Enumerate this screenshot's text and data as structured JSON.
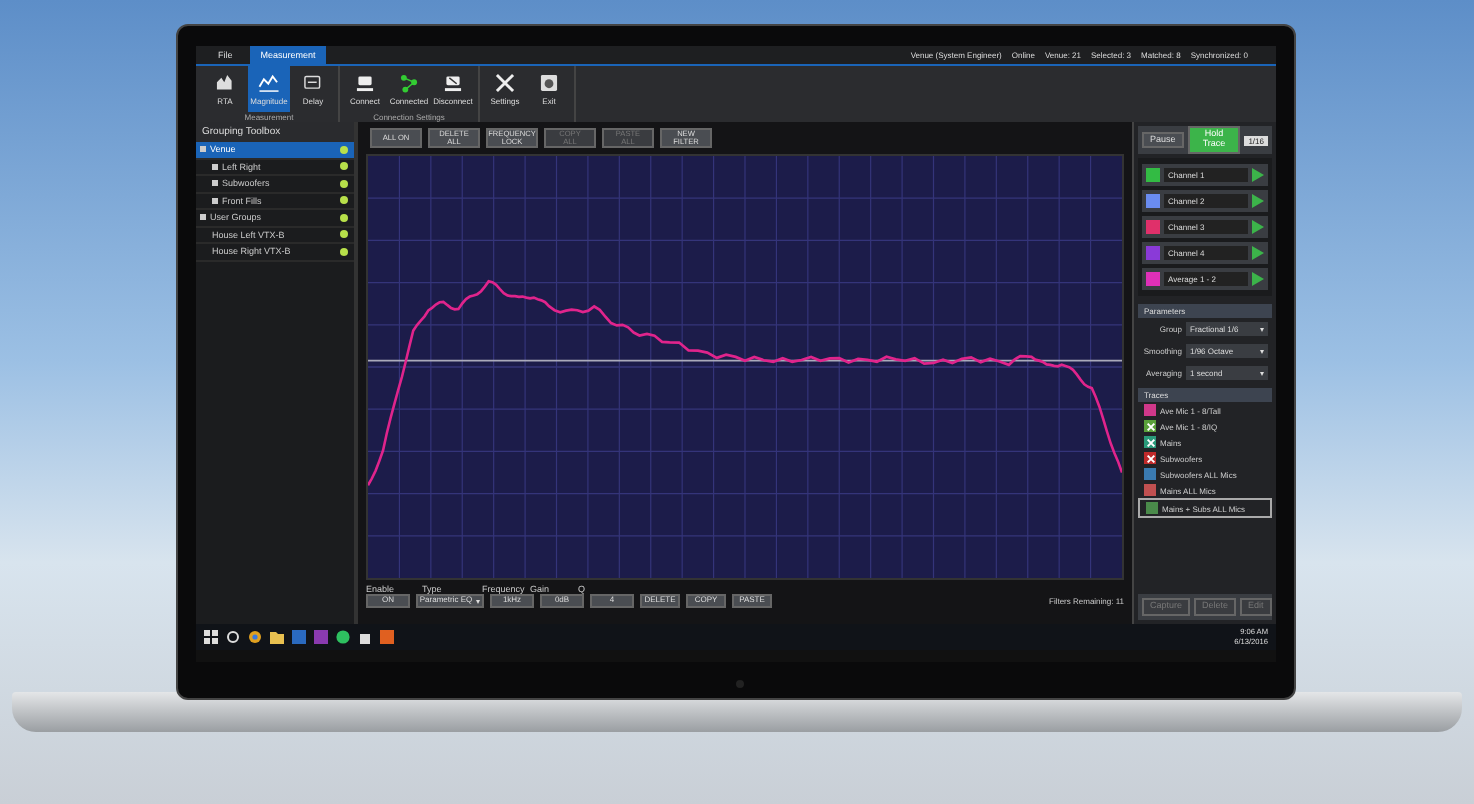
{
  "window": {
    "menu_tabs": [
      {
        "label": "File",
        "selected": false
      },
      {
        "label": "Measurement",
        "selected": true
      }
    ],
    "status": [
      "Venue (System Engineer)",
      "Online",
      "Venue: 21",
      "Selected: 3",
      "Matched: 8",
      "Synchronized: 0"
    ]
  },
  "ribbon": {
    "groups": [
      {
        "label": "Measurement",
        "tools": [
          {
            "label": "RTA",
            "selected": false
          },
          {
            "label": "Magnitude",
            "selected": true
          },
          {
            "label": "Delay",
            "selected": false
          }
        ]
      },
      {
        "label": "Connection Settings",
        "tools": [
          {
            "label": "Connect",
            "selected": false
          },
          {
            "label": "Connected",
            "selected": false
          },
          {
            "label": "Disconnect",
            "selected": false
          }
        ]
      },
      {
        "tools": [
          {
            "label": "Settings",
            "selected": false
          },
          {
            "label": "Exit",
            "selected": false
          }
        ]
      }
    ]
  },
  "sidebar": {
    "title": "Grouping Toolbox",
    "items": [
      {
        "label": "Venue",
        "expanded": true,
        "selected": true,
        "children": [
          {
            "label": "Left Right",
            "expanded": false,
            "selected": false
          },
          {
            "label": "Subwoofers",
            "expanded": false,
            "selected": false
          },
          {
            "label": "Front Fills",
            "expanded": false,
            "selected": false
          }
        ]
      },
      {
        "label": "User Groups",
        "expanded": true,
        "selected": false,
        "children": [
          {
            "label": "House Left VTX-B",
            "selected": false
          },
          {
            "label": "House Right VTX-B",
            "selected": false
          }
        ]
      }
    ]
  },
  "filter_buttons": [
    {
      "label": "ALL ON",
      "disabled": false
    },
    {
      "label": "DELETE ALL",
      "disabled": false
    },
    {
      "label": "FREQUENCY LOCK",
      "disabled": false
    },
    {
      "label": "COPY ALL",
      "disabled": true
    },
    {
      "label": "PASTE ALL",
      "disabled": true
    },
    {
      "label": "NEW FILTER",
      "disabled": false
    }
  ],
  "filter_editor": {
    "labels": [
      "Enable",
      "Type",
      "Frequency",
      "Gain",
      "Q"
    ],
    "enable": "ON",
    "type": "Parametric EQ",
    "frequency": "1kHz",
    "gain": "0dB",
    "q": "4",
    "buttons": [
      "DELETE",
      "COPY",
      "PASTE"
    ],
    "remaining": "Filters Remaining: 11"
  },
  "capture": {
    "pause": "Pause",
    "hold": {
      "label": "Hold Trace",
      "on": true
    },
    "resolution": "1/16"
  },
  "channels": [
    {
      "name": "Channel 1",
      "color": "#33bb44"
    },
    {
      "name": "Channel 2",
      "color": "#6a8cf0"
    },
    {
      "name": "Channel 3",
      "color": "#e0306a"
    },
    {
      "name": "Channel 4",
      "color": "#8a3ad8"
    },
    {
      "name": "Average 1 - 2",
      "color": "#e030b8"
    }
  ],
  "parameters": {
    "title": "Parameters",
    "rows": [
      {
        "label": "Group",
        "value": "Fractional 1/6"
      },
      {
        "label": "Smoothing",
        "value": "1/96 Octave"
      },
      {
        "label": "Averaging",
        "value": "1 second"
      }
    ]
  },
  "traces": {
    "title": "Traces",
    "items": [
      {
        "name": "Ave Mic 1 - 8/Tall",
        "color": "#d0388a",
        "hidden": false,
        "selected": false
      },
      {
        "name": "Ave Mic 1 - 8/IQ",
        "color": "#5aa03a",
        "hidden": true,
        "selected": false
      },
      {
        "name": "Mains",
        "color": "#2a9a7a",
        "hidden": true,
        "selected": false
      },
      {
        "name": "Subwoofers",
        "color": "#c02a2a",
        "hidden": true,
        "selected": false
      },
      {
        "name": "Subwoofers ALL Mics",
        "color": "#3a7ab0",
        "hidden": false,
        "selected": false
      },
      {
        "name": "Mains ALL Mics",
        "color": "#c05050",
        "hidden": false,
        "selected": false
      },
      {
        "name": "Mains + Subs ALL Mics",
        "color": "#4a8a4a",
        "hidden": false,
        "selected": true
      }
    ],
    "buttons": [
      {
        "label": "Capture",
        "disabled": true
      },
      {
        "label": "Delete",
        "disabled": true
      },
      {
        "label": "Edit",
        "disabled": true
      }
    ]
  },
  "taskbar": {
    "time": "9:06 AM",
    "date": "6/13/2016"
  }
}
